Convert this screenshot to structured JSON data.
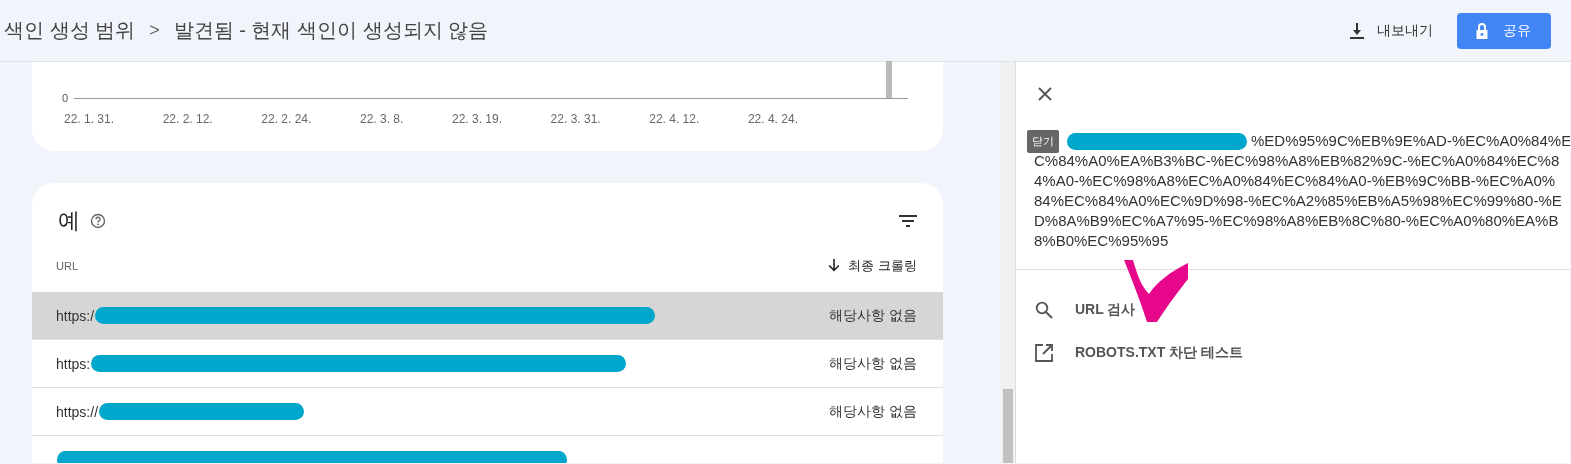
{
  "header": {
    "breadcrumb": [
      "색인 생성 범위",
      "발견됨 - 현재 색인이 생성되지 않음"
    ],
    "separator": ">",
    "export_button": "내보내기",
    "share_button": "공유"
  },
  "chart": {
    "y_tick": "0",
    "x_labels": [
      "22. 1. 31.",
      "22. 2. 12.",
      "22. 2. 24.",
      "22. 3. 8.",
      "22. 3. 19.",
      "22. 3. 31.",
      "22. 4. 12.",
      "22. 4. 24."
    ]
  },
  "examples": {
    "title": "예",
    "columns": [
      "URL",
      "최종 크롤링"
    ],
    "rows": [
      {
        "url": "https:/",
        "last_crawl": "해당사항 없음",
        "selected": true
      },
      {
        "url": "https:",
        "last_crawl": "해당사항 없음",
        "selected": false
      },
      {
        "url": "https://",
        "last_crawl": "해당사항 없음",
        "selected": false
      },
      {
        "selected": false
      }
    ]
  },
  "panel": {
    "tooltip": "닫기",
    "url_text": [
      "%ED%95%9C%EB%9E%AD-%EC%A0%84%E",
      "C%84%A0%EA%B3%BC-%EC%98%A8%EB%82%9C-%EC%A0%84%EC%84%A0-%EC%98%A8%EC%A0%84%EC%84%A0-%EB%9C%BB-%EC%A0%84%EC%84%A0%EC%9D%98-%EC%A2%85%EB%A5%98%EC%99%80-%ED%8A%B9%EC%A7%95-%EC%98%A8%EB%8C%80-%EC%A0%80%EA%B8%B0%EC%95%95"
    ],
    "actions": [
      {
        "kind": "search",
        "label": "URL 검사"
      },
      {
        "kind": "external",
        "label": "ROBOTS.TXT 차단 테스트"
      }
    ]
  }
}
